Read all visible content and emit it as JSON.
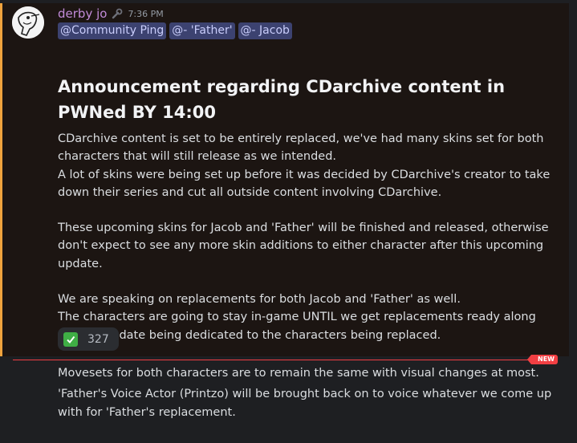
{
  "message": {
    "author": "derby jo",
    "timestamp": "7:36 PM",
    "mentions": [
      "@Community Ping",
      "@- 'Father'",
      "@- Jacob"
    ],
    "heading": "Announcement regarding CDarchive content in PWNed BY 14:00",
    "lines": [
      "CDarchive content is set to be entirely replaced, we've had many skins set for both characters that will still release as we intended.",
      "A lot of skins were being set up before it was decided by CDarchive's creator to take down their series and cut all outside content involving CDarchive.",
      "",
      "These upcoming skins for Jacob and 'Father' will be finished and released, otherwise don't expect to see any more skin additions to either character after this upcoming update.",
      "",
      "We are speaking on replacements for both Jacob and 'Father' as well.",
      "The characters are going to stay in-game UNTIL we get replacements ready along with an update being dedicated to the characters being replaced."
    ],
    "reaction": {
      "emoji": "white-check-mark",
      "count": "327"
    }
  },
  "divider": {
    "label": "NEW"
  },
  "following": [
    "Movesets for both characters are to remain the same with visual changes at most.",
    "'Father's Voice Actor (Printzo) will be brought back on to voice whatever we come up with for 'Father's replacement."
  ],
  "colors": {
    "accent_bar": "#f0a33d",
    "username": "#c28bd9",
    "mention_bg": "#3c4270",
    "new_badge": "#f23f43"
  }
}
